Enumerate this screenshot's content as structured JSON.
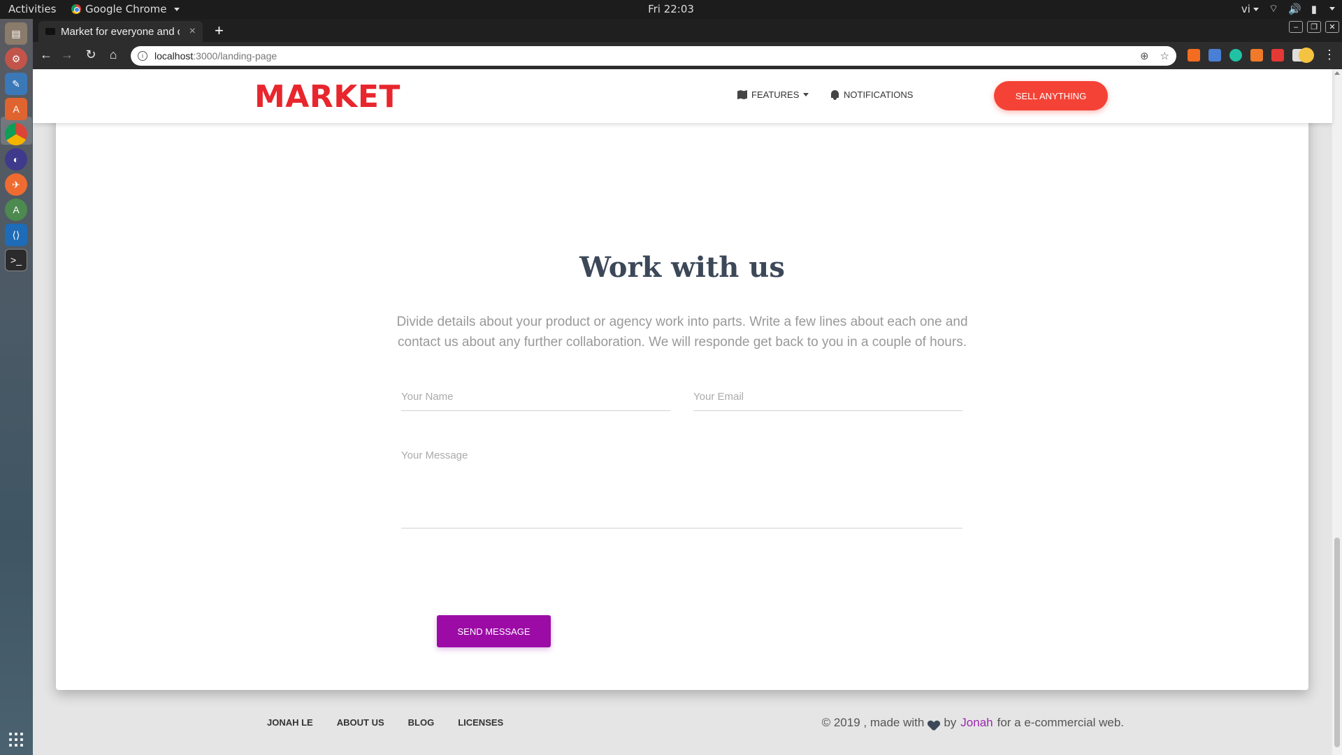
{
  "os": {
    "activities": "Activities",
    "app_name": "Google Chrome",
    "clock": "Fri 22:03",
    "lang": "vi"
  },
  "browser": {
    "tab_title": "Market for everyone and c",
    "url_host": "localhost",
    "url_path": ":3000/landing-page",
    "extensions": [
      "#f26d21",
      "#4a7fd6",
      "#21c2a4",
      "#f07a2a",
      "#e53935",
      "#dddddd"
    ]
  },
  "dock": {
    "items": [
      "files-icon",
      "settings-icon",
      "text-editor-icon",
      "software-center-icon",
      "chrome-icon",
      "eclipse-icon",
      "postman-icon",
      "android-studio-icon",
      "vscode-icon",
      "terminal-icon"
    ]
  },
  "site": {
    "brand": "MARKET",
    "nav": {
      "features": "FEATURES",
      "notifications": "NOTIFICATIONS",
      "sell": "SELL ANYTHING"
    },
    "contact": {
      "title": "Work with us",
      "description": "Divide details about your product or agency work into parts. Write a few lines about each one and contact us about any further collaboration. We will responde get back to you in a couple of hours.",
      "name_placeholder": "Your Name",
      "email_placeholder": "Your Email",
      "message_placeholder": "Your Message",
      "send_label": "SEND MESSAGE"
    },
    "footer": {
      "links": [
        "JONAH LE",
        "ABOUT US",
        "BLOG",
        "LICENSES"
      ],
      "copy_prefix": "© 2019 , made with",
      "copy_by": "by",
      "author": "Jonah",
      "copy_suffix": "for a e-commercial web."
    }
  }
}
